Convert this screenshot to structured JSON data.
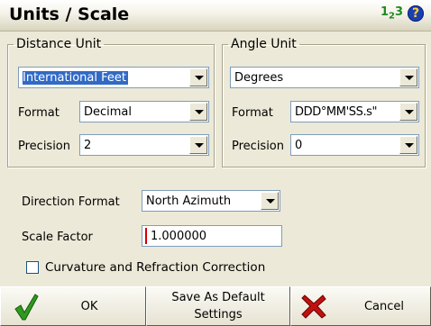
{
  "header": {
    "title": "Units / Scale",
    "icon_123": "1",
    "icon_123_sub": "2",
    "icon_123_tail": "3",
    "help_symbol": "?"
  },
  "distance": {
    "legend": "Distance Unit",
    "unit_value": "International Feet",
    "format_label": "Format",
    "format_value": "Decimal",
    "precision_label": "Precision",
    "precision_value": "2"
  },
  "angle": {
    "legend": "Angle Unit",
    "unit_value": "Degrees",
    "format_label": "Format",
    "format_value": "DDD°MM'SS.s\"",
    "precision_label": "Precision",
    "precision_value": "0"
  },
  "direction": {
    "label": "Direction Format",
    "value": "North Azimuth"
  },
  "scale": {
    "label": "Scale Factor",
    "value": "1.000000"
  },
  "curvature": {
    "label": "Curvature and Refraction Correction",
    "checked": false
  },
  "buttons": {
    "ok": "OK",
    "save_line1": "Save As Default",
    "save_line2": "Settings",
    "cancel": "Cancel"
  },
  "colors": {
    "check_green": "#2e9a1e",
    "cancel_red": "#c01010",
    "selection": "#316ac5"
  }
}
